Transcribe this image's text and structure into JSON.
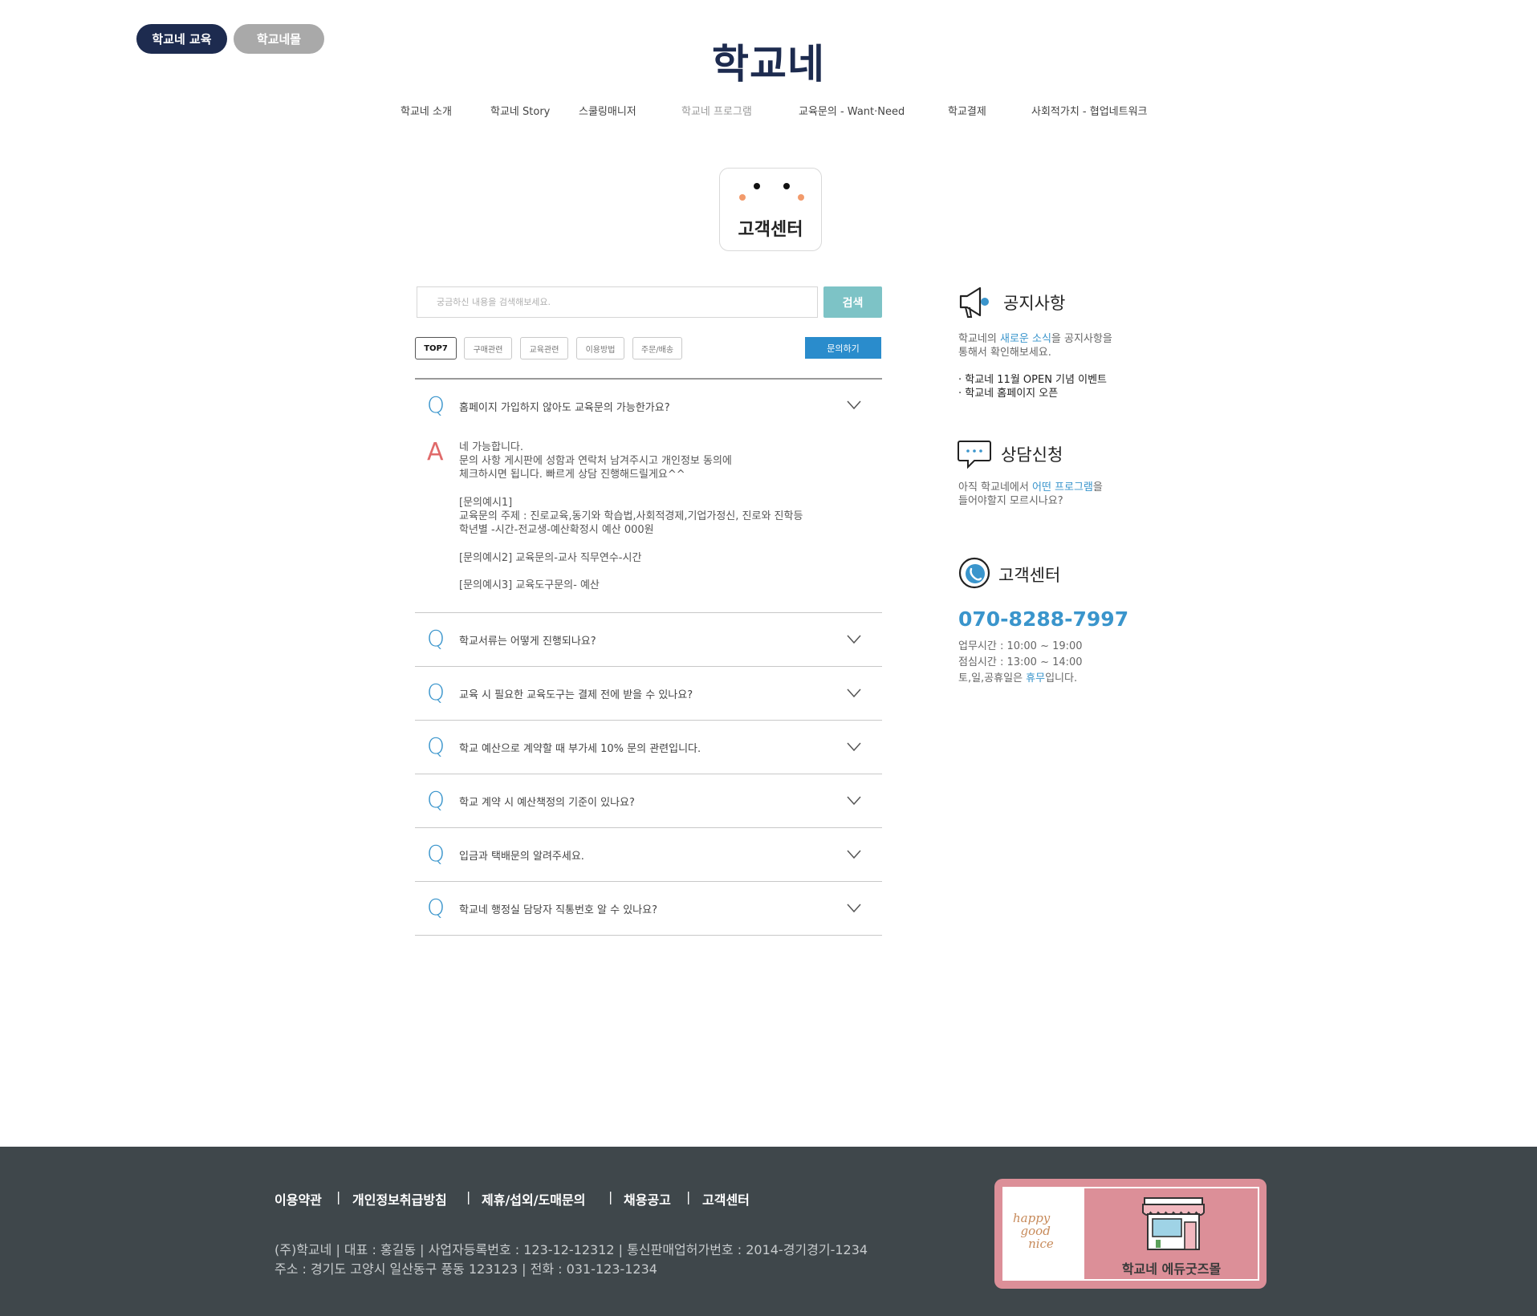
{
  "top_pills": {
    "education": "학교네 교육",
    "mall": "학교네몰"
  },
  "logo": "학교네",
  "nav": [
    "학교네 소개",
    "학교네 Story",
    "스쿨링매니저",
    "학교네 프로그램",
    "교육문의 - Want·Need",
    "학교결제",
    "사회적가치 - 협업네트워크"
  ],
  "customer_center_card": {
    "title": "고객센터"
  },
  "search": {
    "placeholder": "궁금하신 내용을 검색해보세요.",
    "button": "검색"
  },
  "categories": [
    "TOP7",
    "구매관련",
    "교육관련",
    "이용방법",
    "주문/배송"
  ],
  "ask_button": "문의하기",
  "faq": [
    {
      "q": "홈페이지 가입하지 않아도 교육문의 가능한가요?",
      "expanded": true,
      "answer": [
        "네 가능합니다.",
        "문의 사항 게시판에 성함과 연락처 남겨주시고 개인정보 동의에",
        "체크하시면 됩니다. 빠르게 상담 진행해드릴게요^^",
        "",
        "[문의예시1]",
        "교육문의 주제 : 진로교육,동기와 학습법,사회적경제,기업가정신, 진로와 진학등",
        "학년별 -시간-전교생-예산확정시 예산 000원",
        "",
        "[문의예시2] 교육문의-교사 직무연수-시간",
        "",
        "[문의예시3] 교육도구문의- 예산"
      ]
    },
    {
      "q": "학교서류는 어떻게 진행되나요?"
    },
    {
      "q": "교육 시 필요한 교육도구는 결제 전에 받을 수 있나요?"
    },
    {
      "q": "학교 예산으로 계약할 때 부가세 10% 문의 관련입니다."
    },
    {
      "q": "학교 계약 시 예산책정의 기준이 있나요?"
    },
    {
      "q": "입금과 택배문의 알려주세요."
    },
    {
      "q": "학교네 행정실 담당자 직통번호 알 수 있나요?"
    }
  ],
  "letters": {
    "q": "Q",
    "a": "A"
  },
  "sidebar": {
    "notice": {
      "title": "공지사항",
      "desc1_pre": "학교네의 ",
      "desc1_hl": "새로운 소식",
      "desc1_post": "을 공지사항을",
      "desc2": "통해서 확인해보세요.",
      "items": [
        "· 학교네 11월 OPEN 기념 이벤트",
        "· 학교네 홈페이지 오픈"
      ]
    },
    "consult": {
      "title": "상담신청",
      "desc1_pre": "아직 학교네에서 ",
      "desc1_hl": "어떤 프로그램",
      "desc1_post": "을",
      "desc2": "들어야할지 모르시나요?"
    },
    "center": {
      "title": "고객센터",
      "phone": "070-8288-7997",
      "hours": "업무시간 : 10:00 ~ 19:00",
      "lunch": "점심시간 : 13:00 ~ 14:00",
      "holiday_pre": "토,일,공휴일은 ",
      "holiday_hl": "휴무",
      "holiday_post": "입니다."
    }
  },
  "footer": {
    "links": [
      "이용약관",
      "개인정보취급방침",
      "제휴/섭외/도매문의",
      "채용공고",
      "고객센터"
    ],
    "separator": "|",
    "info1": "(주)학교네   |   대표 : 홍길동   |   사업자등록번호 : 123-12-12312   |   통신판매업허가번호 : 2014-경기경기-1234",
    "info2": "주소 : 경기도 고양시 일산동구 풍동 123123   |   전화 : 031-123-1234",
    "banner_label": "학교네 에듀굿즈몰"
  },
  "colors": {
    "navy": "#1d2b4f",
    "gray_pill": "#a9a9a9",
    "accent_blue": "#3a95cc",
    "search_teal": "#7dc3c6",
    "footer_bg": "#3f474b",
    "banner_pink": "#dc8f98"
  }
}
